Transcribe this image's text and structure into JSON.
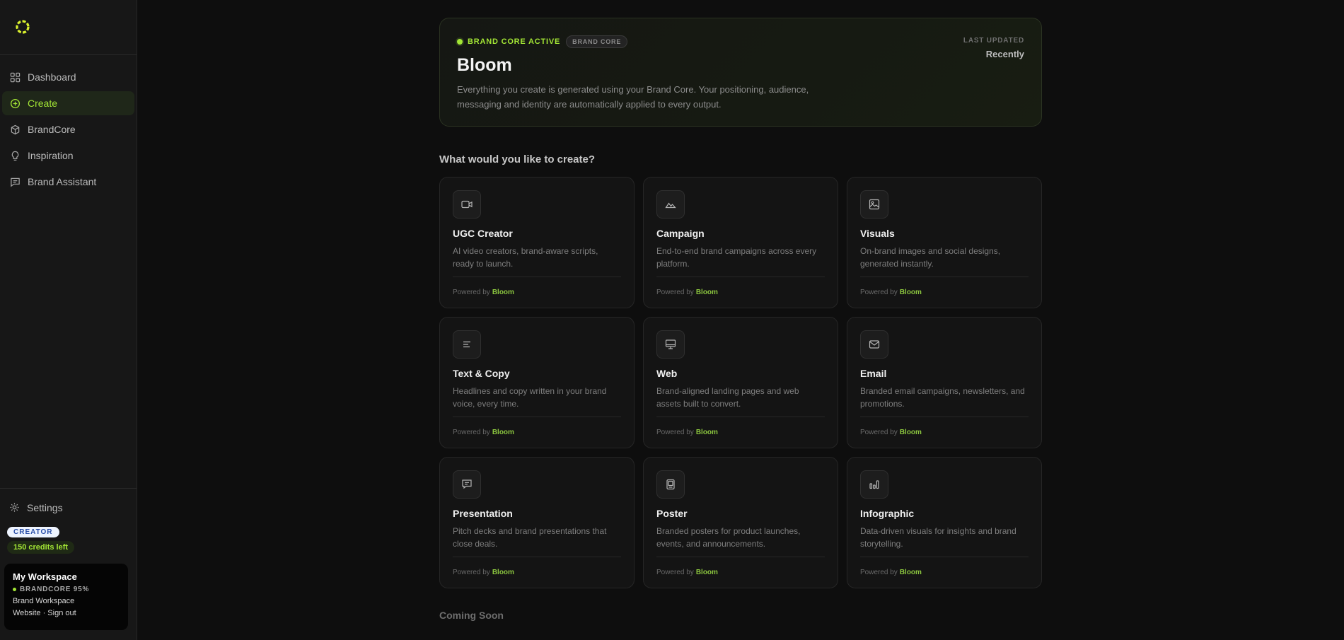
{
  "sidebar": {
    "nav": [
      {
        "label": "Dashboard",
        "icon": "grid-icon",
        "active": false
      },
      {
        "label": "Create",
        "icon": "plus-circle-icon",
        "active": true
      },
      {
        "label": "BrandCore",
        "icon": "cube-icon",
        "active": false
      },
      {
        "label": "Inspiration",
        "icon": "lightbulb-icon",
        "active": false
      },
      {
        "label": "Brand Assistant",
        "icon": "chat-icon",
        "active": false
      }
    ],
    "settings_label": "Settings",
    "plan": "CREATOR",
    "credits": "150 credits left",
    "workspace": {
      "title": "My Workspace",
      "brandcore": "BRANDCORE 95%",
      "line1": "Brand Workspace",
      "line2": "Website · Sign out"
    }
  },
  "hero": {
    "status": "BRAND CORE ACTIVE",
    "badge": "BRAND CORE",
    "title": "Bloom",
    "description": "Everything you create is generated using your Brand Core. Your positioning, audience, messaging and identity are automatically applied to every output.",
    "updated_label": "LAST UPDATED",
    "updated_value": "Recently"
  },
  "create": {
    "heading": "What would you like to create?",
    "powered_prefix": "Powered by",
    "powered_brand": "Bloom",
    "cards": [
      {
        "title": "UGC Creator",
        "desc": "AI video creators, brand-aware scripts, ready to launch.",
        "icon": "video-icon"
      },
      {
        "title": "Campaign",
        "desc": "End-to-end brand campaigns across every platform.",
        "icon": "mountain-icon"
      },
      {
        "title": "Visuals",
        "desc": "On-brand images and social designs, generated instantly.",
        "icon": "image-icon"
      },
      {
        "title": "Text & Copy",
        "desc": "Headlines and copy written in your brand voice, every time.",
        "icon": "text-lines-icon"
      },
      {
        "title": "Web",
        "desc": "Brand-aligned landing pages and web assets built to convert.",
        "icon": "monitor-icon"
      },
      {
        "title": "Email",
        "desc": "Branded email campaigns, newsletters, and promotions.",
        "icon": "mail-icon"
      },
      {
        "title": "Presentation",
        "desc": "Pitch decks and brand presentations that close deals.",
        "icon": "presentation-icon"
      },
      {
        "title": "Poster",
        "desc": "Branded posters for product launches, events, and announcements.",
        "icon": "poster-icon"
      },
      {
        "title": "Infographic",
        "desc": "Data-driven visuals for insights and brand storytelling.",
        "icon": "bar-chart-icon"
      }
    ]
  },
  "coming_soon": "Coming Soon",
  "colors": {
    "accent": "#a3e635",
    "background": "#0e0e0e",
    "sidebar": "#171717"
  }
}
